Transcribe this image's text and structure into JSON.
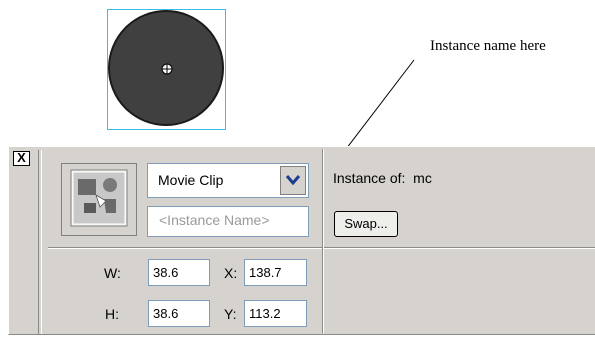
{
  "stage": {
    "symbol_fill": "#404040",
    "selection_color": "#3fb9e6",
    "registration_icon": "crosshair-circle-icon"
  },
  "callout": {
    "text": "Instance name here"
  },
  "panel": {
    "close_label": "X",
    "symbol_icon": "movie-clip-symbol-icon",
    "symbol_type": {
      "selected": "Movie Clip",
      "dropdown_icon": "chevron-down-icon"
    },
    "instance_name": {
      "value": "",
      "placeholder": "<Instance Name>"
    },
    "instance_of": {
      "label": "Instance of:",
      "value": "mc"
    },
    "swap_label": "Swap...",
    "transform": {
      "w_label": "W:",
      "w_value": "38.6",
      "h_label": "H:",
      "h_value": "38.6",
      "x_label": "X:",
      "x_value": "138.7",
      "y_label": "Y:",
      "y_value": "113.2"
    },
    "colors": {
      "panel_bg": "#d6d3ce",
      "field_border": "#7f9db9"
    }
  }
}
